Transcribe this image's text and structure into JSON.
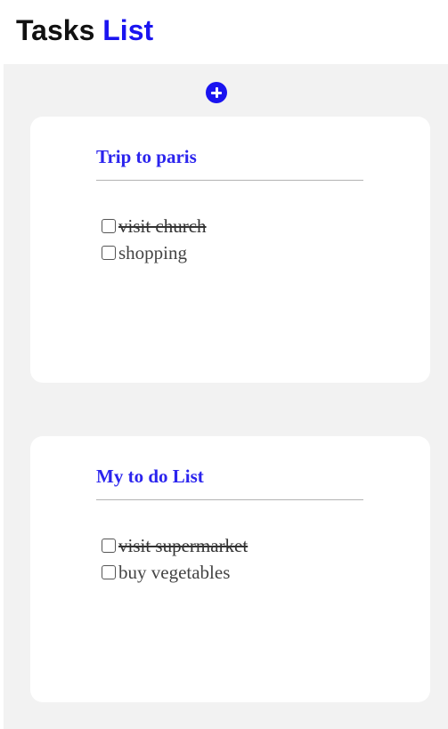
{
  "header": {
    "title_part1": "Tasks",
    "title_part2": "List",
    "accent_color": "#1a14f0"
  },
  "toolbar": {
    "add_icon": "plus-circle-icon"
  },
  "lists": [
    {
      "title": "Trip to paris",
      "tasks": [
        {
          "text": "visit church",
          "completed": true
        },
        {
          "text": "shopping",
          "completed": false
        }
      ]
    },
    {
      "title": "My to do List",
      "tasks": [
        {
          "text": "visit supermarket",
          "completed": true
        },
        {
          "text": "buy vegetables",
          "completed": false
        }
      ]
    }
  ]
}
